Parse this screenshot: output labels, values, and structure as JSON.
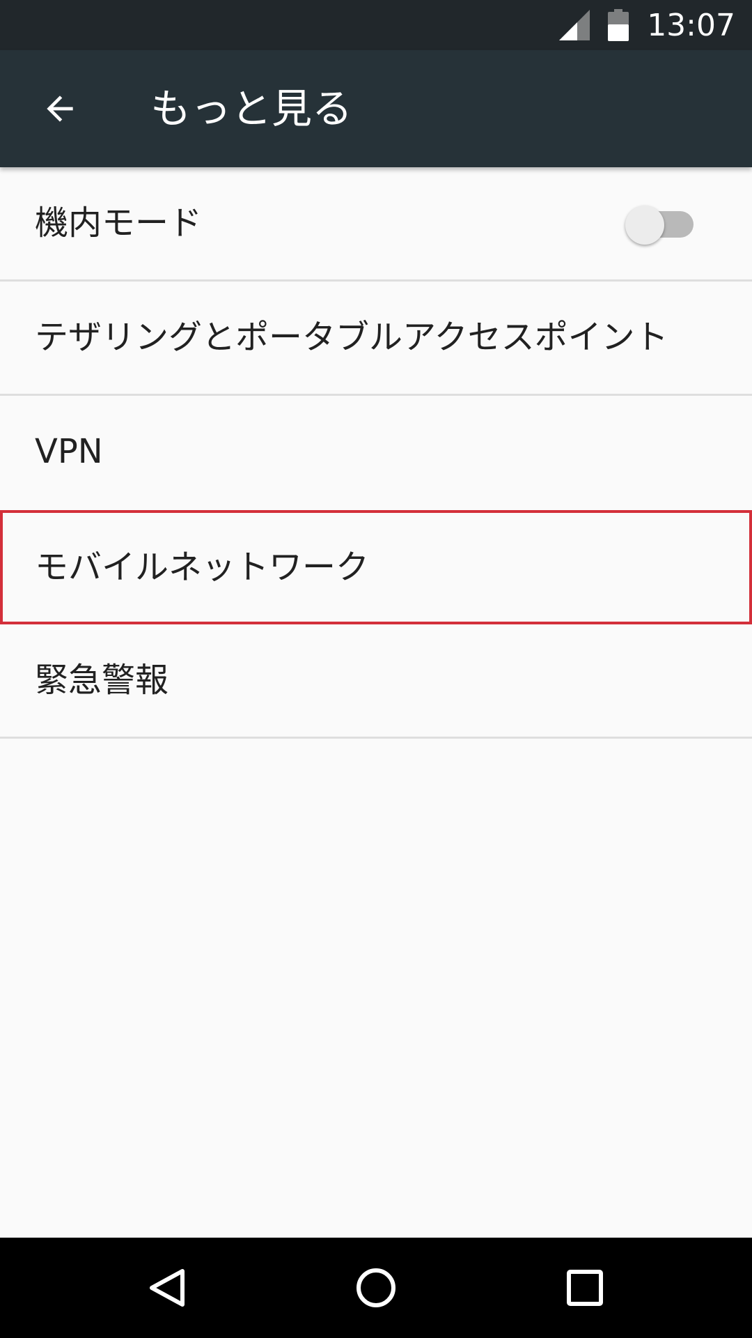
{
  "status_bar": {
    "time": "13:07",
    "icons": [
      "cell-signal-icon",
      "battery-icon"
    ]
  },
  "app_bar": {
    "back_icon": "arrow-back-icon",
    "title": "もっと見る"
  },
  "settings": {
    "items": [
      {
        "label": "機内モード",
        "toggle": {
          "state": "off"
        }
      },
      {
        "label": "テザリングとポータブルアクセスポイント"
      },
      {
        "label": "VPN"
      },
      {
        "label": "モバイルネットワーク",
        "highlighted": true
      },
      {
        "label": "緊急警報"
      }
    ]
  },
  "nav_bar": {
    "icons": [
      "back-triangle-icon",
      "home-circle-icon",
      "recents-square-icon"
    ]
  },
  "colors": {
    "status_bar": "#21272b",
    "app_bar": "#263238",
    "background": "#fafafa",
    "highlight_border": "#d32f3a",
    "nav_bar": "#000000"
  }
}
